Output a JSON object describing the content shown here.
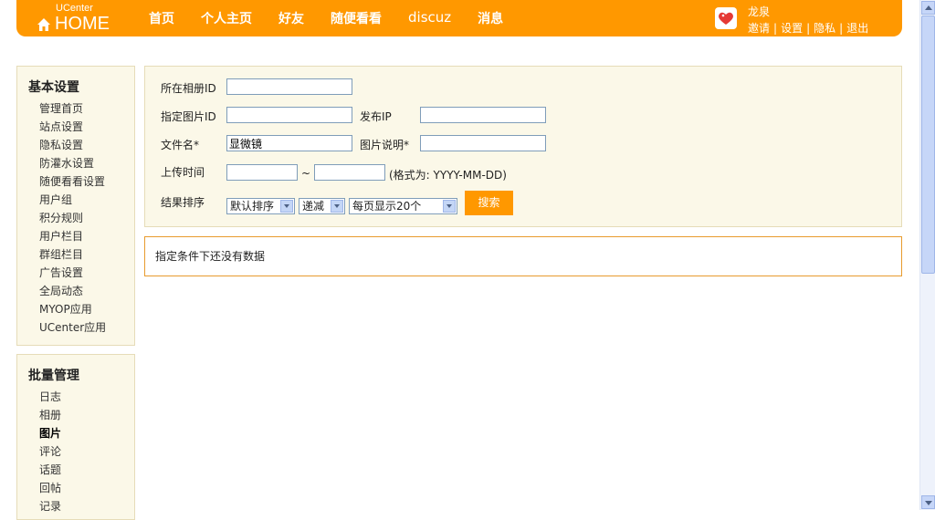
{
  "header": {
    "logo_small": "UCenter",
    "logo_big": "HOME",
    "nav": [
      "首页",
      "个人主页",
      "好友",
      "随便看看",
      "discuz",
      "消息"
    ],
    "user": {
      "name": "龙泉",
      "links": [
        "邀请",
        "设置",
        "隐私",
        "退出"
      ]
    },
    "accent": "#ff9800"
  },
  "sidebar": {
    "basic": {
      "title": "基本设置",
      "items": [
        "管理首页",
        "站点设置",
        "隐私设置",
        "防灌水设置",
        "随便看看设置",
        "用户组",
        "积分规则",
        "用户栏目",
        "群组栏目",
        "广告设置",
        "全局动态",
        "MYOP应用",
        "UCenter应用"
      ]
    },
    "batch": {
      "title": "批量管理",
      "items": [
        "日志",
        "相册",
        "图片",
        "评论",
        "话题",
        "回帖",
        "记录"
      ],
      "active": "图片"
    }
  },
  "form": {
    "album_id_label": "所在相册ID",
    "album_id_value": "",
    "pic_id_label": "指定图片ID",
    "pic_id_value": "",
    "ip_label": "发布IP",
    "ip_value": "",
    "filename_label": "文件名*",
    "filename_value": "显微镜",
    "desc_label": "图片说明*",
    "desc_value": "",
    "time_label": "上传时间",
    "time_from": "",
    "time_sep": "~",
    "time_to": "",
    "time_hint": "(格式为: YYYY-MM-DD)",
    "sort_label": "结果排序",
    "sort_by": "默认排序",
    "sort_order": "递减",
    "per_page": "每页显示20个",
    "search_button": "搜索"
  },
  "result": {
    "empty_text": "指定条件下还没有数据"
  }
}
